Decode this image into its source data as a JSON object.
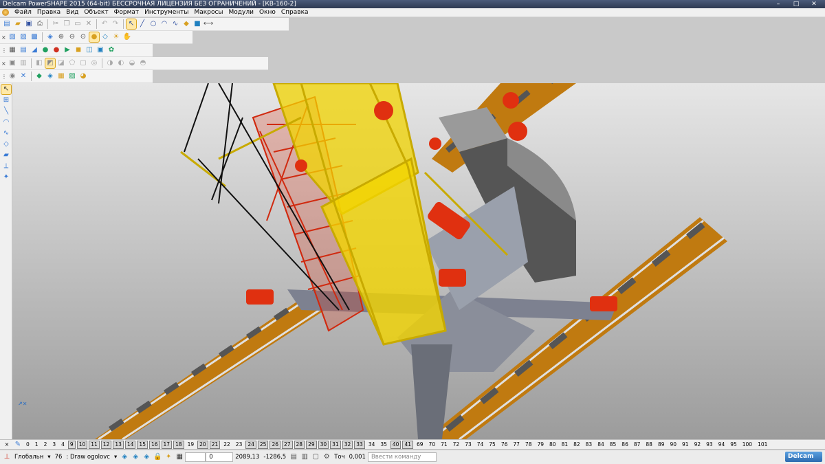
{
  "window": {
    "title": "Delcam PowerSHAPE 2015 (64-bit) БЕССРОЧНАЯ ЛИЦЕНЗИЯ БЕЗ ОГРАНИЧЕНИЙ - [КВ-160-2]",
    "minimize": "–",
    "maximize": "□",
    "close": "✕"
  },
  "menu": [
    "Файл",
    "Правка",
    "Вид",
    "Объект",
    "Формат",
    "Инструменты",
    "Макросы",
    "Модули",
    "Окно",
    "Справка"
  ],
  "toolbars": {
    "row1": [
      "new-icon",
      "open-icon",
      "save-icon",
      "print-icon",
      "cut-icon",
      "copy-icon",
      "paste-icon",
      "delete-icon",
      "undo-icon",
      "redo-icon",
      "select-icon",
      "line-icon",
      "circle-icon",
      "arc-icon",
      "curve-icon",
      "surface-icon",
      "solid-icon",
      "dimension-icon"
    ],
    "row2": [
      "view-top-icon",
      "view-front-icon",
      "view-side-icon",
      "view-iso-icon",
      "zoom-in-icon",
      "zoom-out-icon",
      "zoom-fit-icon",
      "shade-icon",
      "wireframe-icon",
      "light-icon",
      "hand-icon"
    ],
    "row3": [
      "calc-icon",
      "doc-icon",
      "shape-icon",
      "sphere-icon",
      "sphere-red-icon",
      "cone-icon",
      "box-icon",
      "layers-icon",
      "image-icon",
      "gear-icon"
    ],
    "row4": [
      "block-icon",
      "cylinder-icon",
      "extrude-icon",
      "revolve-icon",
      "fillet-icon",
      "chamfer-icon",
      "shell-icon",
      "boolean-icon",
      "split-icon",
      "mirror-icon",
      "pattern-icon",
      "draft-icon"
    ],
    "row5": [
      "solid-tree-icon",
      "feature-icon",
      "shade-solid-icon",
      "edges-icon",
      "measure-icon",
      "analysis-icon",
      "render-icon"
    ]
  },
  "layers": {
    "items": [
      "0",
      "1",
      "2",
      "3",
      "4",
      "9",
      "10",
      "11",
      "12",
      "13",
      "14",
      "15",
      "16",
      "17",
      "18",
      "19",
      "20",
      "21",
      "22",
      "23",
      "24",
      "25",
      "26",
      "27",
      "28",
      "29",
      "30",
      "31",
      "32",
      "33",
      "34",
      "35",
      "40",
      "41",
      "69",
      "70",
      "71",
      "72",
      "73",
      "74",
      "75",
      "76",
      "77",
      "78",
      "79",
      "80",
      "81",
      "82",
      "83",
      "84",
      "85",
      "86",
      "87",
      "88",
      "89",
      "90",
      "91",
      "92",
      "93",
      "94",
      "95",
      "100",
      "101"
    ],
    "active": [
      "9",
      "10",
      "11",
      "12",
      "13",
      "14",
      "15",
      "16",
      "17",
      "18",
      "20",
      "21",
      "24",
      "25",
      "26",
      "27",
      "28",
      "29",
      "30",
      "31",
      "32",
      "33",
      "40",
      "41"
    ]
  },
  "status": {
    "workplane": "Глобальн",
    "level_number": "76",
    "level_name": "Draw ogolovc",
    "value_field": "0",
    "coord_x": "2089,13",
    "coord_y": "-1286,5",
    "tolerance_label": "Точ",
    "tolerance_value": "0,001",
    "command_placeholder": "Ввести команду",
    "brand": "Delcam"
  },
  "colors": {
    "boom": "#f2d400",
    "mast": "#e03010",
    "rail": "#5a5a5a",
    "rail_tie": "#d88a10",
    "base": "#8a8e9a",
    "counterweight": "#8a8a8a"
  }
}
